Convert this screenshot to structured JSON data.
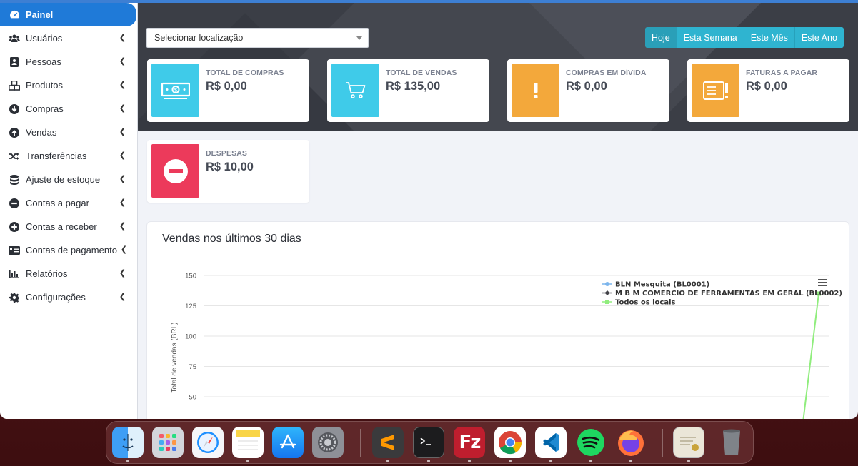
{
  "sidebar": {
    "items": [
      {
        "label": "Painel",
        "icon": "dashboard-icon",
        "active": true
      },
      {
        "label": "Usuários",
        "icon": "users-icon"
      },
      {
        "label": "Pessoas",
        "icon": "contact-card-icon"
      },
      {
        "label": "Produtos",
        "icon": "cubes-icon"
      },
      {
        "label": "Compras",
        "icon": "arrow-circle-down-icon"
      },
      {
        "label": "Vendas",
        "icon": "arrow-circle-up-icon"
      },
      {
        "label": "Transferências",
        "icon": "random-icon"
      },
      {
        "label": "Ajuste de estoque",
        "icon": "database-icon"
      },
      {
        "label": "Contas a pagar",
        "icon": "minus-circle-icon"
      },
      {
        "label": "Contas a receber",
        "icon": "plus-circle-icon"
      },
      {
        "label": "Contas de pagamento",
        "icon": "money-card-icon"
      },
      {
        "label": "Relatórios",
        "icon": "bar-chart-icon"
      },
      {
        "label": "Configurações",
        "icon": "gear-icon"
      }
    ]
  },
  "header": {
    "location_select": "Selecionar localização",
    "period_buttons": [
      "Hoje",
      "Esta Semana",
      "Este Mês",
      "Este Ano"
    ]
  },
  "cards": [
    {
      "label": "TOTAL DE COMPRAS",
      "value": "R$ 0,00",
      "color": "#3fcbe9",
      "icon": "money-bill-icon"
    },
    {
      "label": "TOTAL DE VENDAS",
      "value": "R$ 135,00",
      "color": "#3fcbe9",
      "icon": "cart-icon"
    },
    {
      "label": "COMPRAS EM DÍVIDA",
      "value": "R$ 0,00",
      "color": "#f3a83b",
      "icon": "exclamation-icon"
    },
    {
      "label": "FATURAS A PAGAR",
      "value": "R$ 0,00",
      "color": "#f3a83b",
      "icon": "invoice-alert-icon"
    },
    {
      "label": "DESPESAS",
      "value": "R$ 10,00",
      "color": "#ec3a5b",
      "icon": "minus-circle-icon"
    }
  ],
  "chart_panel": {
    "title": "Vendas nos últimos 30 dias",
    "menu_icon": "hamburger-menu-icon"
  },
  "chart_data": {
    "type": "line",
    "title": "Vendas nos últimos 30 dias",
    "ylabel": "Total de vendas (BRL)",
    "xlabel": "",
    "ylim": [
      50,
      150
    ],
    "y_ticks": [
      150,
      125,
      100,
      75,
      50
    ],
    "legend_position": "top-right",
    "series": [
      {
        "name": "BLN Mesquita (BL0001)",
        "color": "#7cb5ec",
        "marker": "circle"
      },
      {
        "name": "M B M COMERCIO DE FERRAMENTAS EM GERAL (BL0002)",
        "color": "#434348",
        "marker": "diamond"
      },
      {
        "name": "Todos os locais",
        "color": "#90ed7d",
        "marker": "square",
        "last_value": 135
      }
    ]
  },
  "dock": {
    "apps": [
      "finder-icon",
      "launchpad-icon",
      "safari-icon",
      "notes-icon",
      "app-store-icon",
      "system-preferences-icon",
      "sublime-text-icon",
      "terminal-icon",
      "filezilla-icon",
      "chrome-icon",
      "vscode-icon",
      "spotify-icon",
      "firefox-icon",
      "certificate-icon",
      "trash-icon"
    ]
  }
}
